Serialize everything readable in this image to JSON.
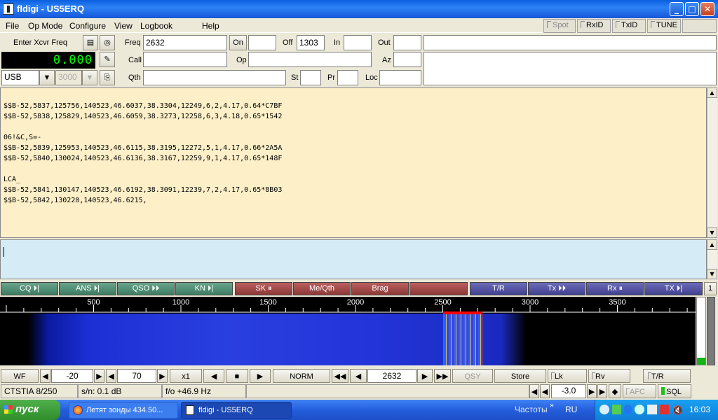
{
  "window": {
    "title": "fldigi - US5ERQ"
  },
  "menu": {
    "items": [
      "File",
      "Op Mode",
      "Configure",
      "View",
      "Logbook",
      "Help"
    ],
    "toggles": [
      "Spot",
      "RxID",
      "TxID",
      "TUNE"
    ]
  },
  "qso": {
    "xcvr_label": "Enter Xcvr Freq",
    "freq_display": "0.000",
    "freq_label": "Freq",
    "freq_value": "2632",
    "on_label": "On",
    "on_value": "",
    "off_label": "Off",
    "off_value": "1303",
    "in_label": "In",
    "in_value": "",
    "out_label": "Out",
    "out_value": "",
    "call_label": "Call",
    "call_value": "",
    "op_label": "Op",
    "op_value": "",
    "az_label": "Az",
    "az_value": "",
    "mode_value": "USB",
    "bw_value": "3000",
    "qth_label": "Qth",
    "qth_value": "",
    "st_label": "St",
    "st_value": "",
    "pr_label": "Pr",
    "pr_value": "",
    "loc_label": "Loc",
    "loc_value": ""
  },
  "rx_text": "$$B-52,5837,125756,140523,46.6037,38.3304,12249,6,2,4.17,0.64*C7BF\n$$B-52,5838,125829,140523,46.6059,38.3273,12258,6,3,4.18,0.65*1542\n\n06!&C,S=-\n$$B-52,5839,125953,140523,46.6115,38.3195,12272,5,1,4.17,0.66*2A5A\n$$B-52,5840,130024,140523,46.6136,38.3167,12259,9,1,4.17,0.65*148F\n\nLCA_\n$$B-52,5841,130147,140523,46.6192,38.3091,12239,7,2,4.17,0.65*8B03\n$$B-52,5842,130220,140523,46.6215,",
  "macros": [
    {
      "label": "CQ ⏵|",
      "color": "green"
    },
    {
      "label": "ANS ⏵|",
      "color": "green"
    },
    {
      "label": "QSO ⏵⏵",
      "color": "green"
    },
    {
      "label": "KN ⏵|",
      "color": "green"
    },
    {
      "label": "SK ⏸",
      "color": "red"
    },
    {
      "label": "Me/Qth",
      "color": "red"
    },
    {
      "label": "Brag",
      "color": "red"
    },
    {
      "label": "",
      "color": "red"
    },
    {
      "label": "T/R",
      "color": "blue"
    },
    {
      "label": "Tx ⏵⏵",
      "color": "blue"
    },
    {
      "label": "Rx ⏸",
      "color": "blue"
    },
    {
      "label": "TX ⏵|",
      "color": "blue"
    }
  ],
  "macro_set": "1",
  "scale": {
    "ticks": [
      "500",
      "1000",
      "1500",
      "2000",
      "2500",
      "3000",
      "3500"
    ]
  },
  "controls": {
    "wf_label": "WF",
    "wf_ref": "-20",
    "wf_range": "70",
    "zoom": "x1",
    "norm": "NORM",
    "freq": "2632",
    "qsy": "QSY",
    "store": "Store",
    "lk": "Lk",
    "rv": "Rv",
    "tr": "T/R"
  },
  "status": {
    "mode": "CTSTIA 8/250",
    "sn": "s/n:  0.1 dB",
    "fo": "f/o +46.9 Hz",
    "squelch_value": "-3.0",
    "afc": "AFC",
    "sql": "SQL"
  },
  "taskbar": {
    "start": "пуск",
    "tasks": [
      "Летят зонды 434.50...",
      "fldigi - US5ERQ"
    ],
    "toolbar_label": "Частоты",
    "lang": "RU",
    "clock": "16:03"
  }
}
